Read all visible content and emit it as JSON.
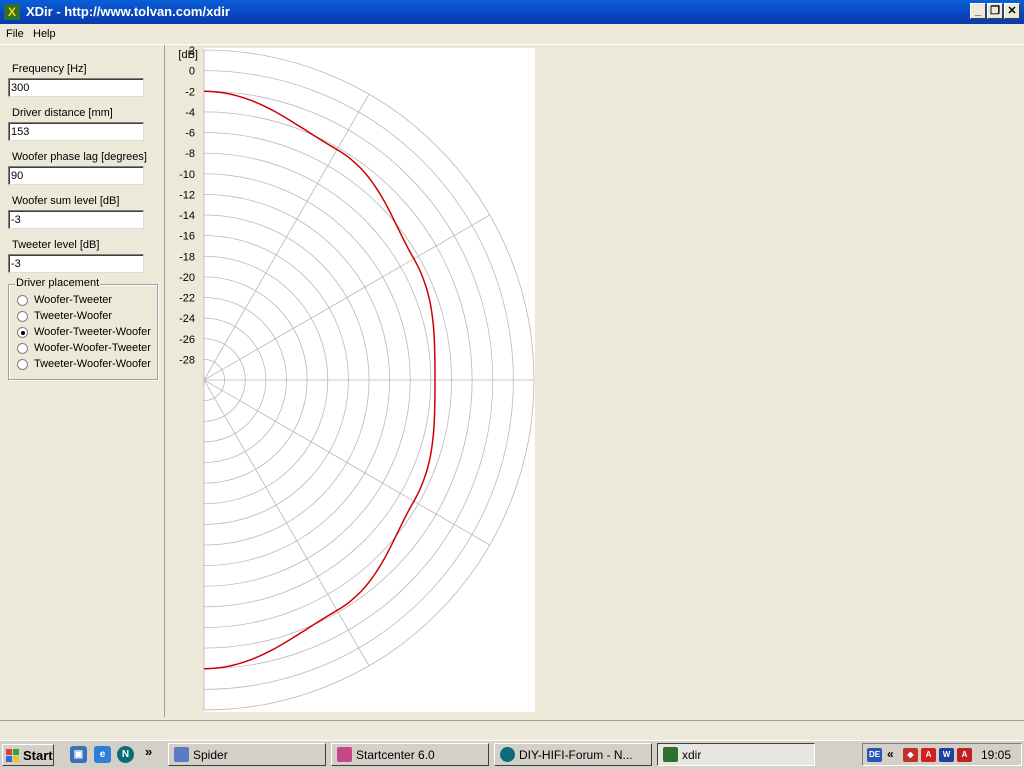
{
  "window": {
    "title": "XDir - http://www.tolvan.com/xdir",
    "minimize": "_",
    "restore": "❐",
    "close": "✕",
    "icon": "xdir-app-icon"
  },
  "menu": {
    "items": [
      "File",
      "Help"
    ]
  },
  "params": {
    "frequency": {
      "label": "Frequency [Hz]",
      "value": "300"
    },
    "driver_distance": {
      "label": "Driver distance [mm]",
      "value": "153"
    },
    "woofer_phase_lag": {
      "label": "Woofer phase lag [degrees]",
      "value": "90"
    },
    "woofer_sum_level": {
      "label": "Woofer sum level [dB]",
      "value": "-3"
    },
    "tweeter_level": {
      "label": "Tweeter level [dB]",
      "value": "-3"
    }
  },
  "placement": {
    "title": "Driver placement",
    "options": [
      "Woofer-Tweeter",
      "Tweeter-Woofer",
      "Woofer-Tweeter-Woofer",
      "Woofer-Woofer-Tweeter",
      "Tweeter-Woofer-Woofer"
    ],
    "selected": 2
  },
  "chart_data": {
    "type": "line",
    "subtype": "polar-half",
    "unit_label": "[dB]",
    "radial_ticks": [
      "2",
      "0",
      "-2",
      "-4",
      "-6",
      "-8",
      "-10",
      "-12",
      "-14",
      "-16",
      "-18",
      "-20",
      "-22",
      "-24",
      "-26",
      "-28"
    ],
    "rlim": [
      -30,
      2
    ],
    "angular_step_deg": 30,
    "series": [
      {
        "color": "#d00000",
        "angle_deg": [
          -90,
          -60,
          -30,
          0,
          30,
          60,
          90
        ],
        "level_db": [
          -2.0,
          -4.2,
          -6.5,
          -7.6,
          -6.5,
          -4.2,
          -2.0
        ]
      }
    ],
    "grid": true
  },
  "taskbar": {
    "start": "Start",
    "quick_launch": [
      "desktop-icon",
      "ie-icon",
      "netscape-icon"
    ],
    "chevron": "»",
    "tasks": [
      {
        "label": "Spider",
        "icon": "spider-icon",
        "active": false
      },
      {
        "label": "Startcenter 6.0",
        "icon": "startcenter-icon",
        "active": false
      },
      {
        "label": "DIY-HIFI-Forum - N...",
        "icon": "netscape-icon",
        "active": false
      },
      {
        "label": "xdir",
        "icon": "xdir-app-icon",
        "active": true
      }
    ],
    "lang": "DE",
    "tray_chevron": "«",
    "clock": "19:05"
  },
  "colors": {
    "titlebar": "#0a4fd0",
    "curve": "#d00000",
    "grid": "#b8b8b8",
    "face": "#ece9d8"
  }
}
